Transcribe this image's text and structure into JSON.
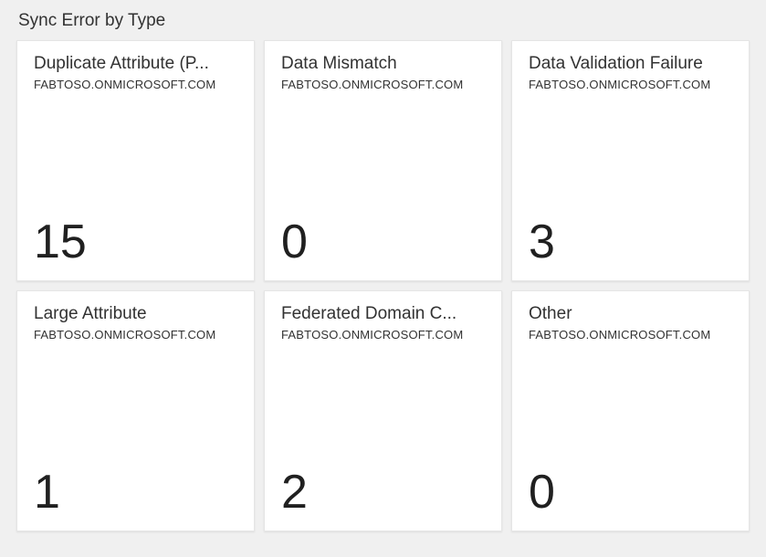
{
  "header": {
    "title": "Sync Error by Type"
  },
  "tiles": [
    {
      "title": "Duplicate Attribute (P...",
      "subtitle": "FABTOSO.ONMICROSOFT.COM",
      "value": "15"
    },
    {
      "title": "Data Mismatch",
      "subtitle": "FABTOSO.ONMICROSOFT.COM",
      "value": "0"
    },
    {
      "title": "Data Validation Failure",
      "subtitle": "FABTOSO.ONMICROSOFT.COM",
      "value": "3"
    },
    {
      "title": "Large Attribute",
      "subtitle": "FABTOSO.ONMICROSOFT.COM",
      "value": "1"
    },
    {
      "title": "Federated Domain C...",
      "subtitle": "FABTOSO.ONMICROSOFT.COM",
      "value": "2"
    },
    {
      "title": "Other",
      "subtitle": "FABTOSO.ONMICROSOFT.COM",
      "value": "0"
    }
  ]
}
